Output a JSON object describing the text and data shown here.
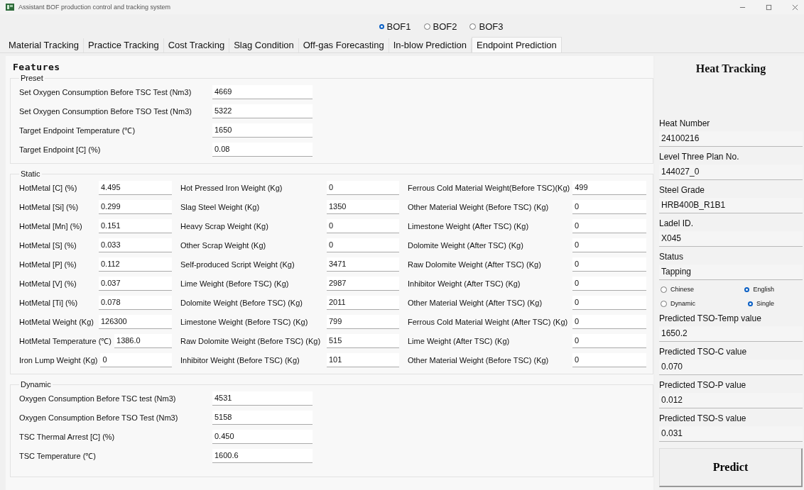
{
  "window": {
    "title": "Assistant BOF production control and tracking system"
  },
  "furnaces": [
    {
      "label": "BOF1",
      "selected": true
    },
    {
      "label": "BOF2",
      "selected": false
    },
    {
      "label": "BOF3",
      "selected": false
    }
  ],
  "tabs": [
    {
      "label": "Material Tracking",
      "selected": false
    },
    {
      "label": "Practice Tracking",
      "selected": false
    },
    {
      "label": "Cost Tracking",
      "selected": false
    },
    {
      "label": "Slag Condition",
      "selected": false
    },
    {
      "label": "Off-gas Forecasting",
      "selected": false
    },
    {
      "label": "In-blow Prediction",
      "selected": false
    },
    {
      "label": "Endpoint Prediction",
      "selected": true
    }
  ],
  "features": {
    "title": "Features",
    "preset": {
      "title": "Preset",
      "fields": [
        {
          "label": "Set Oxygen Consumption Before TSC Test (Nm3)",
          "value": "4669"
        },
        {
          "label": "Set Oxygen Consumption Before TSO Test (Nm3)",
          "value": "5322"
        },
        {
          "label": "Target Endpoint Temperature (℃)",
          "value": "1650"
        },
        {
          "label": "Target Endpoint [C] (%)",
          "value": "0.08"
        }
      ]
    },
    "static": {
      "title": "Static",
      "columns": [
        [
          {
            "label": "HotMetal [C] (%)",
            "value": "4.495"
          },
          {
            "label": "HotMetal [Si] (%)",
            "value": "0.299"
          },
          {
            "label": "HotMetal [Mn] (%)",
            "value": "0.151"
          },
          {
            "label": "HotMetal [S] (%)",
            "value": "0.033"
          },
          {
            "label": "HotMetal [P] (%)",
            "value": "0.112"
          },
          {
            "label": "HotMetal [V] (%)",
            "value": "0.037"
          },
          {
            "label": "HotMetal [Ti] (%)",
            "value": "0.078"
          },
          {
            "label": "HotMetal Weight (Kg)",
            "value": "126300"
          },
          {
            "label": "HotMetal Temperature (℃)",
            "value": "1386.0"
          },
          {
            "label": "Iron Lump Weight (Kg)",
            "value": "0"
          }
        ],
        [
          {
            "label": "Hot Pressed Iron Weight (Kg)",
            "value": "0"
          },
          {
            "label": "Slag Steel Weight (Kg)",
            "value": "1350"
          },
          {
            "label": "Heavy Scrap Weight (Kg)",
            "value": "0"
          },
          {
            "label": "Other Scrap Weight (Kg)",
            "value": "0"
          },
          {
            "label": "Self-produced Script Weight (Kg)",
            "value": "3471"
          },
          {
            "label": "Lime Weight (Before TSC) (Kg)",
            "value": "2987"
          },
          {
            "label": "Dolomite Weight (Before TSC) (Kg)",
            "value": "2011"
          },
          {
            "label": "Limestone Weight (Before TSC) (Kg)",
            "value": "799"
          },
          {
            "label": "Raw Dolomite Weight (Before TSC) (Kg)",
            "value": "515"
          },
          {
            "label": "Inhibitor Weight (Before TSC) (Kg)",
            "value": "101"
          }
        ],
        [
          {
            "label": "Ferrous Cold Material Weight(Before TSC)(Kg)",
            "value": "499"
          },
          {
            "label": "Other Material Weight (Before TSC) (Kg)",
            "value": "0"
          },
          {
            "label": "Limestone Weight (After TSC) (Kg)",
            "value": "0"
          },
          {
            "label": "Dolomite Weight (After TSC) (Kg)",
            "value": "0"
          },
          {
            "label": "Raw Dolomite Weight (After TSC) (Kg)",
            "value": "0"
          },
          {
            "label": "Inhibitor Weight (After TSC) (Kg)",
            "value": "0"
          },
          {
            "label": "Other Material Weight (After TSC) (Kg)",
            "value": "0"
          },
          {
            "label": "Ferrous Cold Material Weight (After TSC) (Kg)",
            "value": "0"
          },
          {
            "label": "Lime Weight (After TSC) (Kg)",
            "value": "0"
          },
          {
            "label": "Other Material Weight (Before TSC) (Kg)",
            "value": "0"
          }
        ]
      ]
    },
    "dynamic": {
      "title": "Dynamic",
      "fields": [
        {
          "label": "Oxygen Consumption Before TSC test (Nm3)",
          "value": "4531"
        },
        {
          "label": "Oxygen Consumption Before TSO Test (Nm3)",
          "value": "5158"
        },
        {
          "label": "TSC Thermal Arrest [C] (%)",
          "value": "0.450"
        },
        {
          "label": "TSC Temperature (℃)",
          "value": "1600.6"
        }
      ]
    }
  },
  "heat_tracking": {
    "title": "Heat Tracking",
    "fields": [
      {
        "label": "Heat Number",
        "value": "24100216"
      },
      {
        "label": "Level Three Plan No.",
        "value": "144027_0"
      },
      {
        "label": "Steel Grade",
        "value": "HRB400B_R1B1"
      },
      {
        "label": "Ladel ID.",
        "value": "X045"
      },
      {
        "label": "Status",
        "value": "Tapping"
      }
    ],
    "radio_groups": [
      [
        {
          "label": "Chinese",
          "selected": false
        },
        {
          "label": "English",
          "selected": true
        }
      ],
      [
        {
          "label": "Dynamic",
          "selected": false
        },
        {
          "label": "Single",
          "selected": true
        }
      ]
    ],
    "predictions": [
      {
        "label": "Predicted TSO-Temp value",
        "value": "1650.2"
      },
      {
        "label": "Predicted TSO-C value",
        "value": "0.070"
      },
      {
        "label": "Predicted TSO-P value",
        "value": "0.012"
      },
      {
        "label": "Predicted TSO-S value",
        "value": "0.031"
      }
    ],
    "predict_button": "Predict"
  }
}
